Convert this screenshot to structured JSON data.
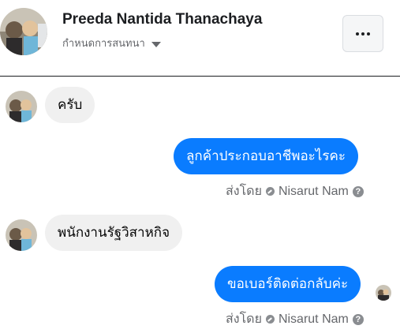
{
  "header": {
    "name": "Preeda Nantida Thanachaya",
    "subtitle": "กำหนดการสนทนา"
  },
  "messages": [
    {
      "side": "in",
      "text": "ครับ"
    },
    {
      "side": "out",
      "text": "ลูกค้าประกอบอาชีพอะไรคะ",
      "sent_by_label": "ส่งโดย",
      "sender": "Nisarut Nam",
      "help": "?"
    },
    {
      "side": "in",
      "text": "พนักงานรัฐวิสาหกิจ"
    },
    {
      "side": "out",
      "text": "ขอเบอร์ติดต่อกลับค่ะ",
      "sent_by_label": "ส่งโดย",
      "sender": "Nisarut Nam",
      "help": "?"
    }
  ],
  "colors": {
    "outgoing_bubble": "#0a7cff",
    "incoming_bubble": "#f0f0f0",
    "meta_text": "#65676b"
  },
  "icons": {
    "more": "more-horizontal-icon",
    "dropdown": "caret-down-icon",
    "verified": "check-circle-icon",
    "help": "question-circle-icon"
  }
}
